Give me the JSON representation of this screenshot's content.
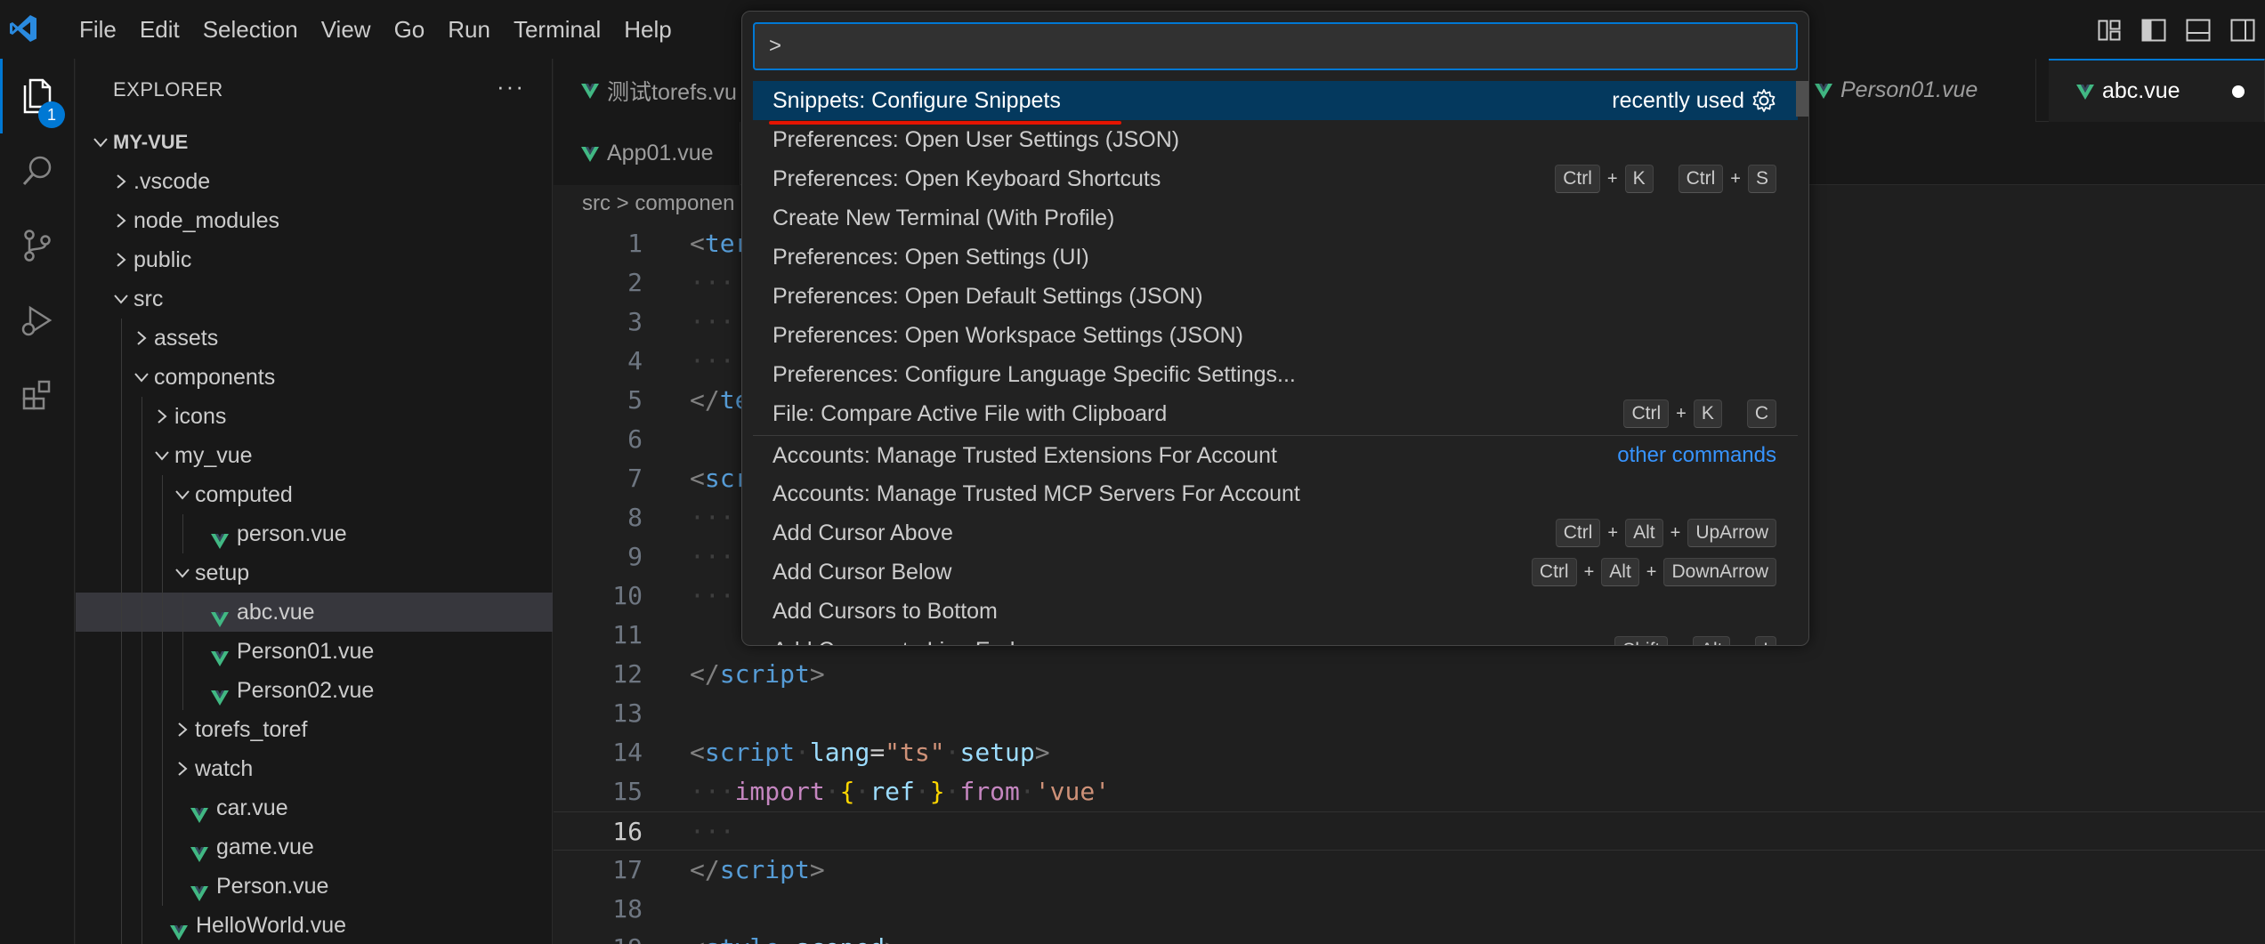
{
  "menu": [
    "File",
    "Edit",
    "Selection",
    "View",
    "Go",
    "Run",
    "Terminal",
    "Help"
  ],
  "activity": {
    "explorer_badge": "1"
  },
  "sidebar": {
    "title": "EXPLORER",
    "more": "···",
    "tree": [
      {
        "label": "MY-VUE",
        "depth": 0,
        "type": "root-open"
      },
      {
        "label": ".vscode",
        "depth": 1,
        "type": "folder-closed"
      },
      {
        "label": "node_modules",
        "depth": 1,
        "type": "folder-closed"
      },
      {
        "label": "public",
        "depth": 1,
        "type": "folder-closed"
      },
      {
        "label": "src",
        "depth": 1,
        "type": "folder-open"
      },
      {
        "label": "assets",
        "depth": 2,
        "type": "folder-closed"
      },
      {
        "label": "components",
        "depth": 2,
        "type": "folder-open"
      },
      {
        "label": "icons",
        "depth": 3,
        "type": "folder-closed"
      },
      {
        "label": "my_vue",
        "depth": 3,
        "type": "folder-open"
      },
      {
        "label": "computed",
        "depth": 4,
        "type": "folder-open"
      },
      {
        "label": "person.vue",
        "depth": 5,
        "type": "vue"
      },
      {
        "label": "setup",
        "depth": 4,
        "type": "folder-open"
      },
      {
        "label": "abc.vue",
        "depth": 5,
        "type": "vue",
        "selected": true
      },
      {
        "label": "Person01.vue",
        "depth": 5,
        "type": "vue"
      },
      {
        "label": "Person02.vue",
        "depth": 5,
        "type": "vue"
      },
      {
        "label": "torefs_toref",
        "depth": 4,
        "type": "folder-closed"
      },
      {
        "label": "watch",
        "depth": 4,
        "type": "folder-closed"
      },
      {
        "label": "car.vue",
        "depth": 4,
        "type": "vue"
      },
      {
        "label": "game.vue",
        "depth": 4,
        "type": "vue"
      },
      {
        "label": "Person.vue",
        "depth": 4,
        "type": "vue"
      },
      {
        "label": "HelloWorld.vue",
        "depth": 3,
        "type": "vue"
      }
    ]
  },
  "tabs": {
    "row1": [
      {
        "label": "测试torefs.vu",
        "italic": false
      },
      {
        "label": "Person01.vue",
        "italic": true
      },
      {
        "label": "abc.vue",
        "italic": false,
        "active": true,
        "dirty": true
      }
    ],
    "row2": [
      {
        "label": "App01.vue",
        "italic": false
      }
    ]
  },
  "breadcrumb": "src > componen",
  "editor": {
    "current_line": 16,
    "lines": [
      {
        "n": "1",
        "html": "<span class=\"tg\">&lt;</span><span class=\"tn\">ter</span>"
      },
      {
        "n": "2",
        "html": "<span class=\"ws\">···</span>"
      },
      {
        "n": "3",
        "html": "<span class=\"ws\">···</span>"
      },
      {
        "n": "4",
        "html": "<span class=\"ws\">···</span>"
      },
      {
        "n": "5",
        "html": "<span class=\"tg\">&lt;/</span><span class=\"tn\">te</span>"
      },
      {
        "n": "6",
        "html": ""
      },
      {
        "n": "7",
        "html": "<span class=\"tg\">&lt;</span><span class=\"tn\">scr</span>"
      },
      {
        "n": "8",
        "html": "<span class=\"ws\">···</span>"
      },
      {
        "n": "9",
        "html": "<span class=\"ws\">···</span>"
      },
      {
        "n": "10",
        "html": "<span class=\"ws\">···</span>"
      },
      {
        "n": "11",
        "html": ""
      },
      {
        "n": "12",
        "html": "<span class=\"tg\">&lt;/</span><span class=\"tn\">script</span><span class=\"tg\">&gt;</span>"
      },
      {
        "n": "13",
        "html": ""
      },
      {
        "n": "14",
        "html": "<span class=\"tg\">&lt;</span><span class=\"tn\">script</span><span class=\"ws\">·</span><span class=\"at\">lang</span>=<span class=\"st\">\"ts\"</span><span class=\"ws\">·</span><span class=\"at\">setup</span><span class=\"tg\">&gt;</span>"
      },
      {
        "n": "15",
        "html": "<span class=\"ws\">···</span><span class=\"kw\">import</span><span class=\"ws\">·</span><span class=\"br\">{</span><span class=\"ws\">·</span><span class=\"vr\">ref</span><span class=\"ws\">·</span><span class=\"br\">}</span><span class=\"ws\">·</span><span class=\"kw\">from</span><span class=\"ws\">·</span><span class=\"st\">'vue'</span>"
      },
      {
        "n": "16",
        "html": "<span class=\"ws\">···</span>"
      },
      {
        "n": "17",
        "html": "<span class=\"tg\">&lt;/</span><span class=\"tn\">script</span><span class=\"tg\">&gt;</span>"
      },
      {
        "n": "18",
        "html": ""
      },
      {
        "n": "19",
        "html": "<span class=\"tg\">&lt;</span><span class=\"tn\">style</span><span class=\"ws\">·</span><span class=\"at\">scoped</span><span class=\"tg\">&gt;</span>"
      }
    ]
  },
  "palette": {
    "input_value": ">",
    "items": [
      {
        "label": "Snippets: Configure Snippets",
        "tag": "recently used",
        "gear": true,
        "focused": true
      },
      {
        "label": "Preferences: Open User Settings (JSON)"
      },
      {
        "label": "Preferences: Open Keyboard Shortcuts",
        "keys": [
          [
            "Ctrl",
            "K"
          ],
          [
            "Ctrl",
            "S"
          ]
        ]
      },
      {
        "label": "Create New Terminal (With Profile)"
      },
      {
        "label": "Preferences: Open Settings (UI)"
      },
      {
        "label": "Preferences: Open Default Settings (JSON)"
      },
      {
        "label": "Preferences: Open Workspace Settings (JSON)"
      },
      {
        "label": "Preferences: Configure Language Specific Settings..."
      },
      {
        "label": "File: Compare Active File with Clipboard",
        "keys": [
          [
            "Ctrl",
            "K"
          ],
          [
            "C"
          ]
        ]
      },
      {
        "label": "Accounts: Manage Trusted Extensions For Account",
        "other": "other commands",
        "separator": true
      },
      {
        "label": "Accounts: Manage Trusted MCP Servers For Account"
      },
      {
        "label": "Add Cursor Above",
        "keys": [
          [
            "Ctrl",
            "Alt",
            "UpArrow"
          ]
        ]
      },
      {
        "label": "Add Cursor Below",
        "keys": [
          [
            "Ctrl",
            "Alt",
            "DownArrow"
          ]
        ]
      },
      {
        "label": "Add Cursors to Bottom"
      },
      {
        "label": "Add Cursors to Line Ends",
        "keys": [
          [
            "Shift",
            "Alt",
            "I"
          ]
        ]
      }
    ]
  },
  "colors": {
    "accent": "#0078d4",
    "vue_green": "#41b883",
    "underline_red": "#e51400"
  }
}
